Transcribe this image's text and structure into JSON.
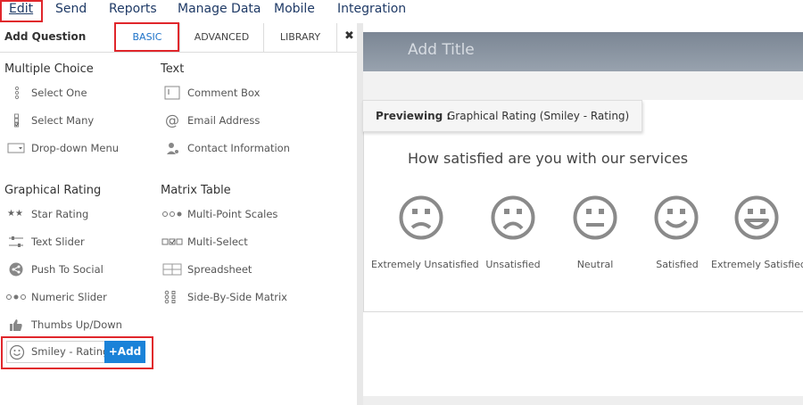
{
  "menu": {
    "items": [
      {
        "label": "Edit"
      },
      {
        "label": "Send"
      },
      {
        "label": "Reports"
      },
      {
        "label": "Manage Data"
      },
      {
        "label": "Mobile"
      },
      {
        "label": "Integration"
      }
    ]
  },
  "panel": {
    "title": "Add Question",
    "tabs": [
      {
        "label": "BASIC"
      },
      {
        "label": "ADVANCED"
      },
      {
        "label": "LIBRARY"
      }
    ],
    "close": "✖"
  },
  "sections": {
    "multiple_choice": {
      "title": "Multiple Choice",
      "items": [
        {
          "label": "Select One",
          "icon": "radio-list-icon"
        },
        {
          "label": "Select Many",
          "icon": "checkbox-list-icon"
        },
        {
          "label": "Drop-down Menu",
          "icon": "dropdown-icon"
        }
      ]
    },
    "text": {
      "title": "Text",
      "items": [
        {
          "label": "Comment Box",
          "icon": "comment-box-icon"
        },
        {
          "label": "Email Address",
          "icon": "at-icon"
        },
        {
          "label": "Contact Information",
          "icon": "contact-icon"
        }
      ]
    },
    "graphical_rating": {
      "title": "Graphical Rating",
      "items": [
        {
          "label": "Star Rating",
          "icon": "star-icon"
        },
        {
          "label": "Text Slider",
          "icon": "slider-icon"
        },
        {
          "label": "Push To Social",
          "icon": "share-icon"
        },
        {
          "label": "Numeric Slider",
          "icon": "dots-icon"
        },
        {
          "label": "Thumbs Up/Down",
          "icon": "thumbs-up-icon"
        },
        {
          "label": "Smiley - Rating",
          "icon": "smiley-icon"
        }
      ]
    },
    "matrix_table": {
      "title": "Matrix Table",
      "items": [
        {
          "label": "Multi-Point Scales",
          "icon": "dots-icon"
        },
        {
          "label": "Multi-Select",
          "icon": "multi-select-icon"
        },
        {
          "label": "Spreadsheet",
          "icon": "spreadsheet-icon"
        },
        {
          "label": "Side-By-Side Matrix",
          "icon": "matrix-icon"
        }
      ]
    }
  },
  "add_button": {
    "label": "+Add"
  },
  "preview": {
    "title_placeholder": "Add Title",
    "previewing_label": "Previewing :",
    "previewing_value": "Graphical Rating (Smiley - Rating)",
    "question": "How satisfied are you with our services",
    "options": [
      {
        "label": "Extremely Unsatisfied",
        "mood": "very-sad"
      },
      {
        "label": "Unsatisfied",
        "mood": "sad"
      },
      {
        "label": "Neutral",
        "mood": "neutral"
      },
      {
        "label": "Satisfied",
        "mood": "happy"
      },
      {
        "label": "Extremely Satisfied",
        "mood": "very-happy"
      }
    ]
  },
  "colors": {
    "highlight": "#e0262b",
    "accent": "#1a82d8",
    "menu_text": "#1f3a66",
    "smiley": "#8a8a8a"
  }
}
